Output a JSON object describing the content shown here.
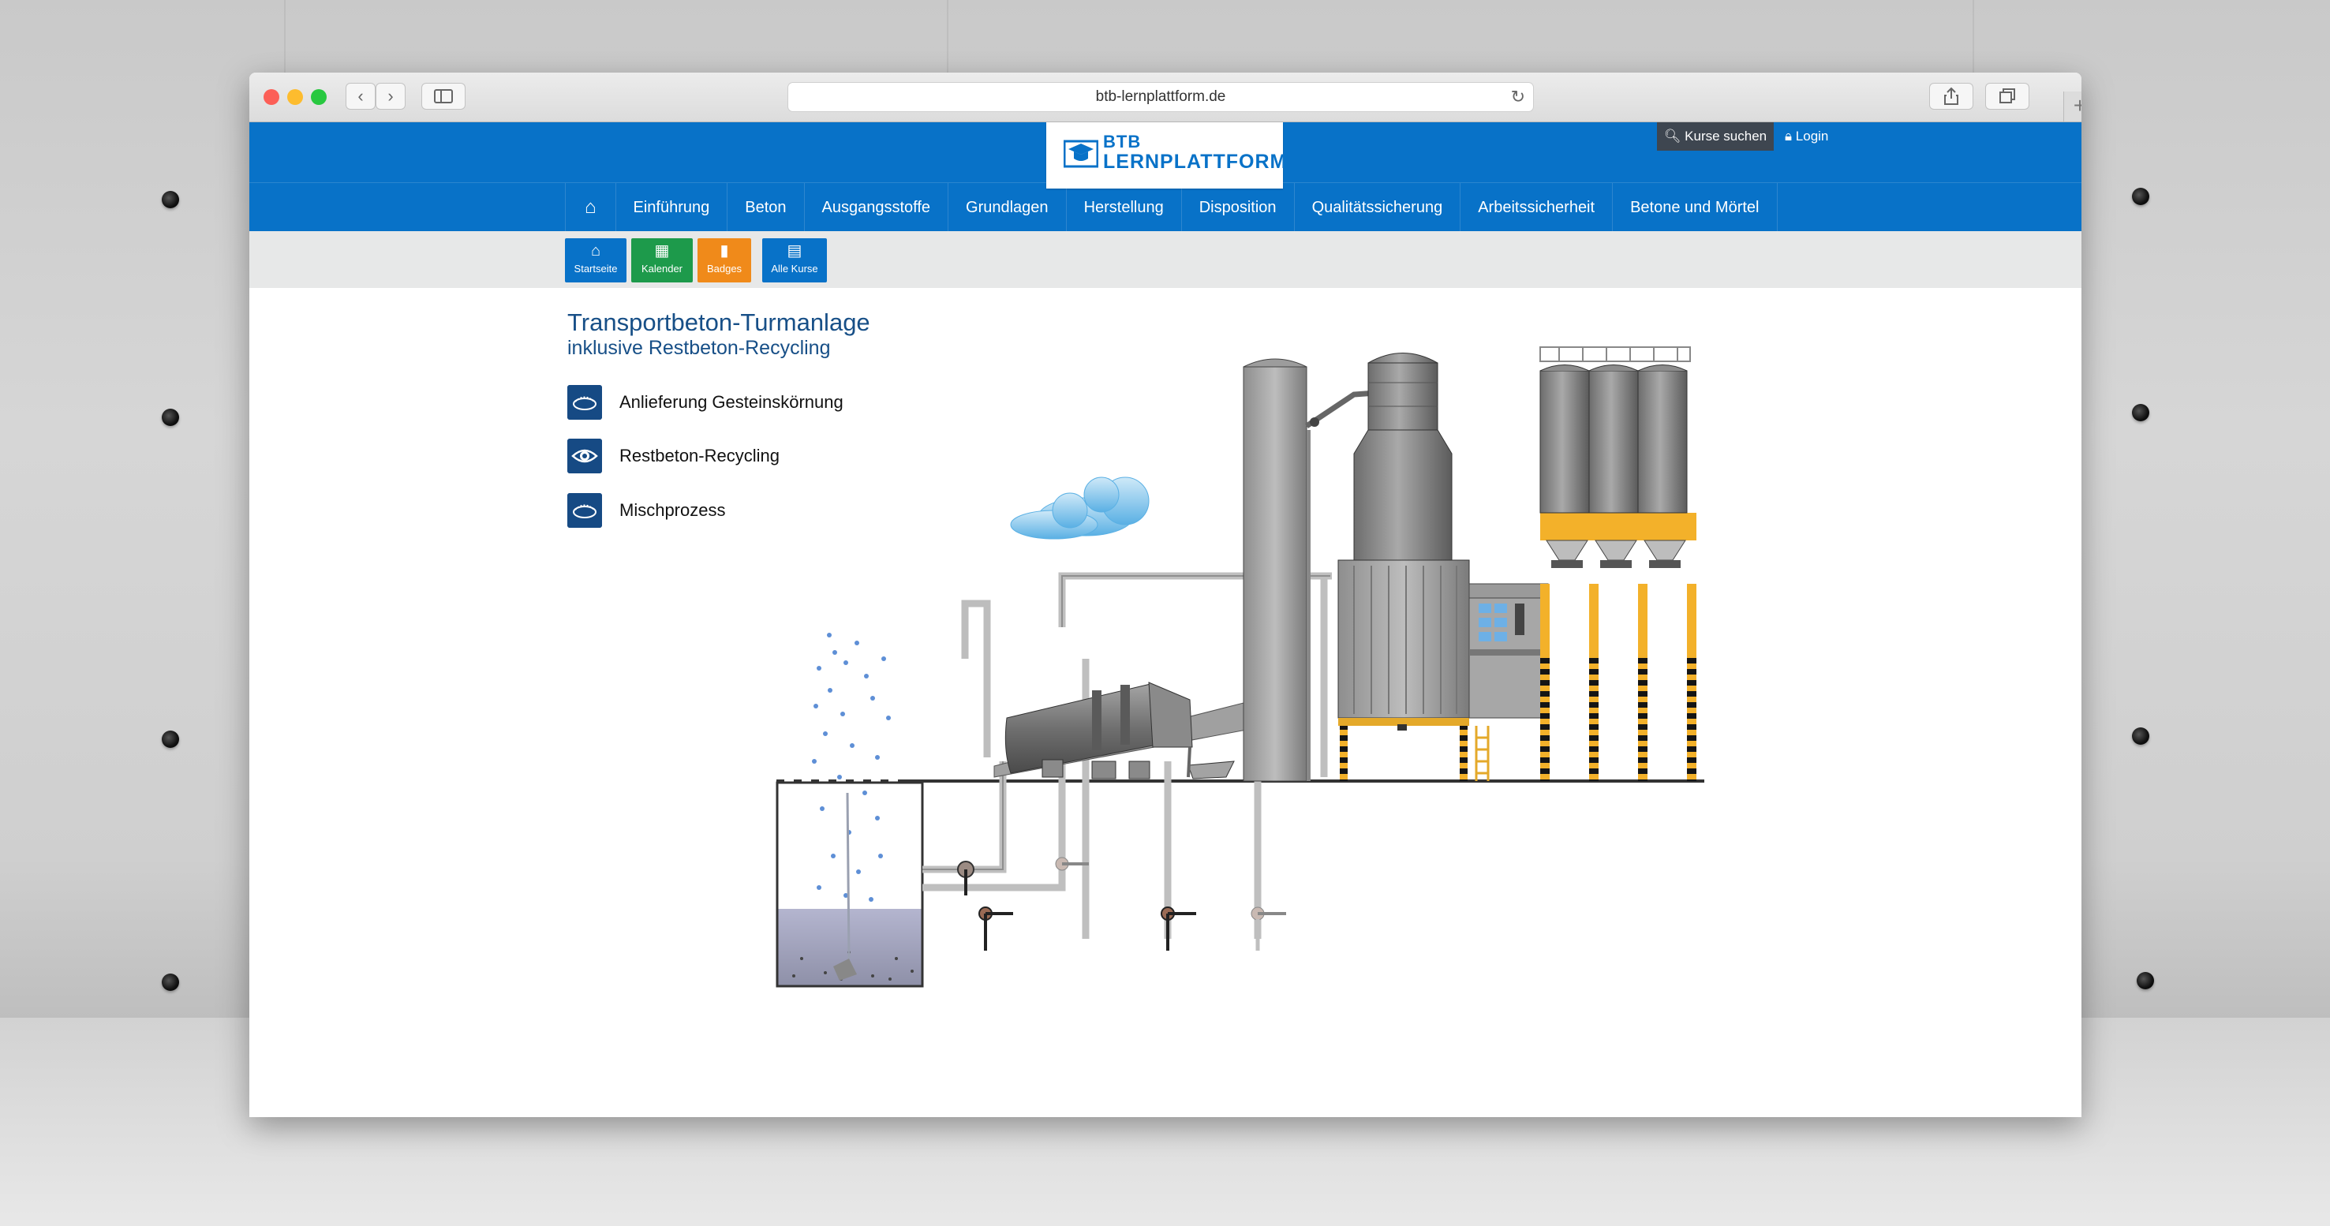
{
  "browser": {
    "url": "btb-lernplattform.de",
    "back_icon": "chevron-left-icon",
    "forward_icon": "chevron-right-icon",
    "sidebar_icon": "sidebar-icon",
    "reload_icon": "reload-icon",
    "share_icon": "share-icon",
    "tabs_icon": "tabs-icon",
    "new_tab_label": "+"
  },
  "site": {
    "logo": {
      "line1": "BTB",
      "line2": "LERNPLATTFORM"
    },
    "search_button": "Kurse suchen",
    "login_link": "Login",
    "colors": {
      "primary": "#0872c8",
      "green": "#1d9a4b",
      "orange": "#f08a1a",
      "dark": "#3e4650",
      "title": "#174f87"
    }
  },
  "nav": {
    "home_icon": "home-icon",
    "items": [
      "Einführung",
      "Beton",
      "Ausgangsstoffe",
      "Grundlagen",
      "Herstellung",
      "Disposition",
      "Qualitätssicherung",
      "Arbeitssicherheit",
      "Betone und Mörtel"
    ]
  },
  "quick": [
    {
      "label": "Startseite",
      "icon": "home-icon",
      "glyph": "⌂"
    },
    {
      "label": "Kalender",
      "icon": "calendar-icon",
      "glyph": "▦"
    },
    {
      "label": "Badges",
      "icon": "bookmark-icon",
      "glyph": "▮"
    },
    {
      "label": "Alle Kurse",
      "icon": "book-icon",
      "glyph": "▤"
    }
  ],
  "content": {
    "title": "Transportbeton-Turmanlage",
    "subtitle": "inklusive Restbeton-Recycling",
    "legend": [
      {
        "label": "Anlieferung Gesteinskörnung",
        "icon": "hotspot-icon"
      },
      {
        "label": "Restbeton-Recycling",
        "icon": "eye-icon"
      },
      {
        "label": "Mischprozess",
        "icon": "hotspot-icon"
      }
    ]
  }
}
